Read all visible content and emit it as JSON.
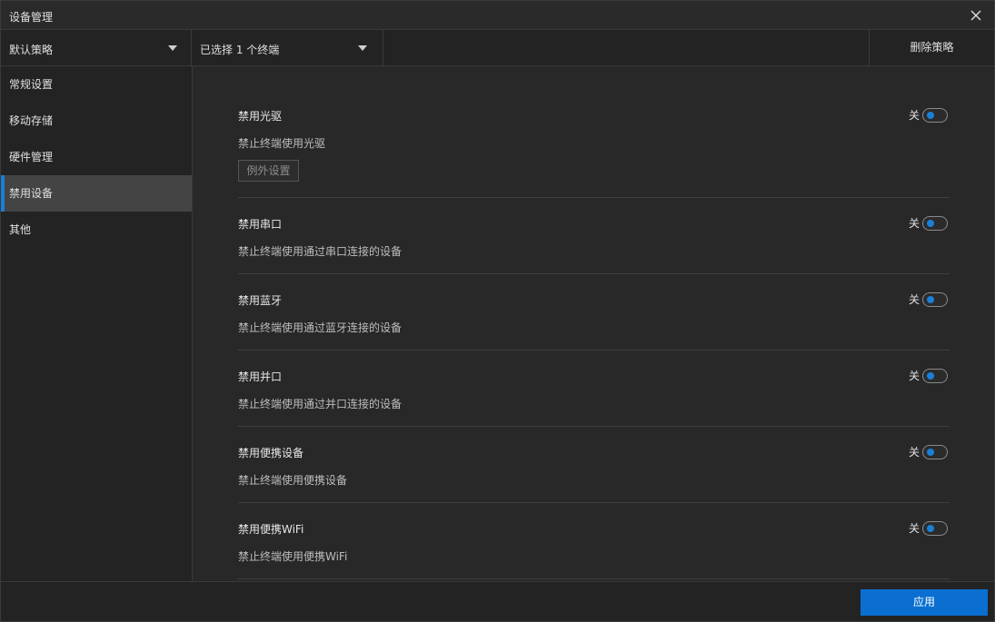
{
  "window": {
    "title": "设备管理",
    "close_icon": "close-icon"
  },
  "toolbar": {
    "policy_dropdown": {
      "value": "默认策略"
    },
    "terminal_dropdown": {
      "value": "已选择 1 个终端"
    },
    "delete_label": "删除策略"
  },
  "sidebar": {
    "items": [
      {
        "label": "常规设置",
        "active": false
      },
      {
        "label": "移动存储",
        "active": false
      },
      {
        "label": "硬件管理",
        "active": false
      },
      {
        "label": "禁用设备",
        "active": true
      },
      {
        "label": "其他",
        "active": false
      }
    ]
  },
  "settings": [
    {
      "title": "禁用光驱",
      "description": "禁止终端使用光驱",
      "toggle_label": "关",
      "enabled": false,
      "exception_label": "例外设置"
    },
    {
      "title": "禁用串口",
      "description": "禁止终端使用通过串口连接的设备",
      "toggle_label": "关",
      "enabled": false
    },
    {
      "title": "禁用蓝牙",
      "description": "禁止终端使用通过蓝牙连接的设备",
      "toggle_label": "关",
      "enabled": false
    },
    {
      "title": "禁用并口",
      "description": "禁止终端使用通过并口连接的设备",
      "toggle_label": "关",
      "enabled": false
    },
    {
      "title": "禁用便携设备",
      "description": "禁止终端使用便携设备",
      "toggle_label": "关",
      "enabled": false
    },
    {
      "title": "禁用便携WiFi",
      "description": "禁止终端使用便携WiFi",
      "toggle_label": "关",
      "enabled": false
    }
  ],
  "footer": {
    "apply_label": "应用"
  },
  "colors": {
    "accent": "#1a7fd8",
    "apply_button": "#0a6fd0",
    "background": "#282828"
  }
}
